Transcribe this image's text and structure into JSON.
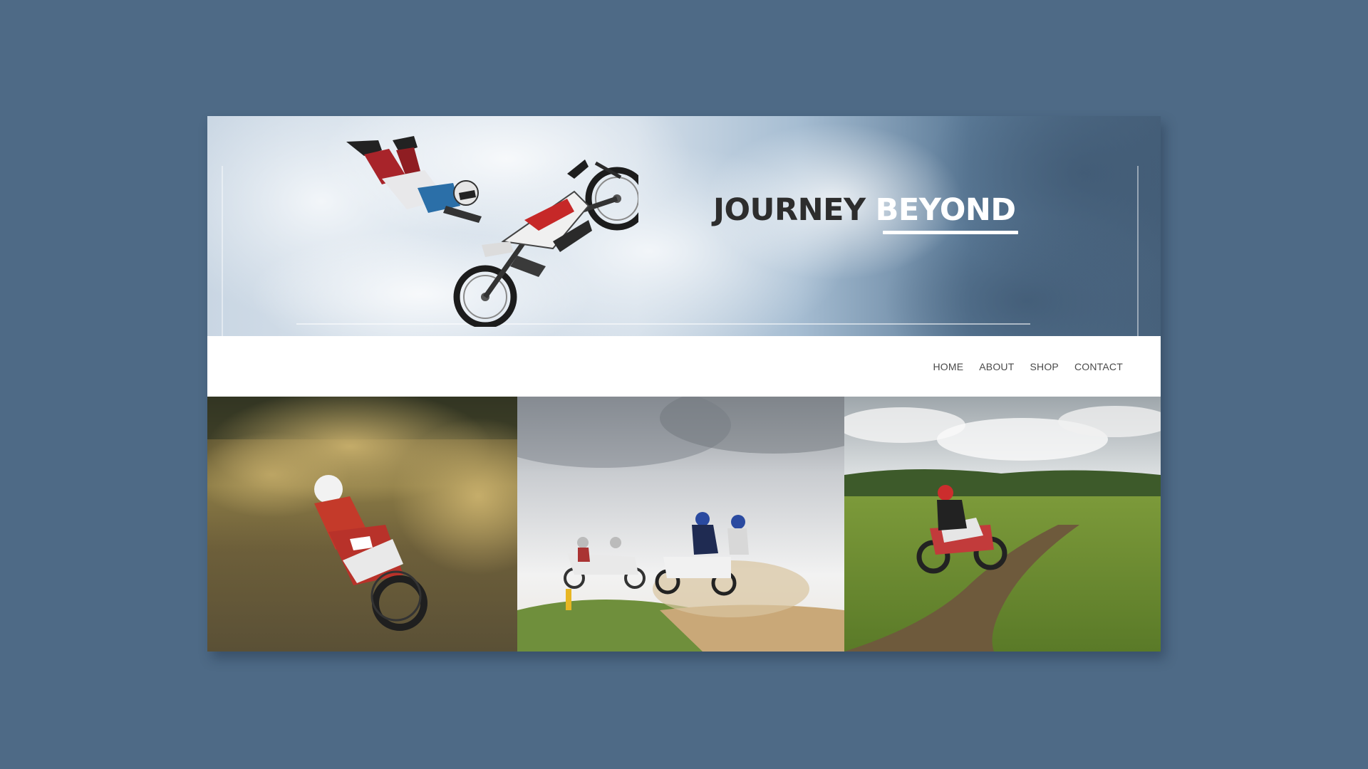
{
  "hero": {
    "title_word1": "JOURNEY",
    "title_word2": "BEYOND",
    "image": "motocross-rider-jump-sky"
  },
  "nav": {
    "items": [
      {
        "label": "HOME"
      },
      {
        "label": "ABOUT"
      },
      {
        "label": "SHOP"
      },
      {
        "label": "CONTACT"
      }
    ]
  },
  "gallery": {
    "photos": [
      {
        "subject": "motocross-rider-dust"
      },
      {
        "subject": "sidecar-motocross-race"
      },
      {
        "subject": "dirt-bike-field-trail"
      }
    ]
  },
  "colors": {
    "page_background": "#4e6a86",
    "card_background": "#ffffff",
    "title_dark": "#2d2d2d",
    "title_light": "#ffffff",
    "nav_text": "#4a4a4a"
  }
}
